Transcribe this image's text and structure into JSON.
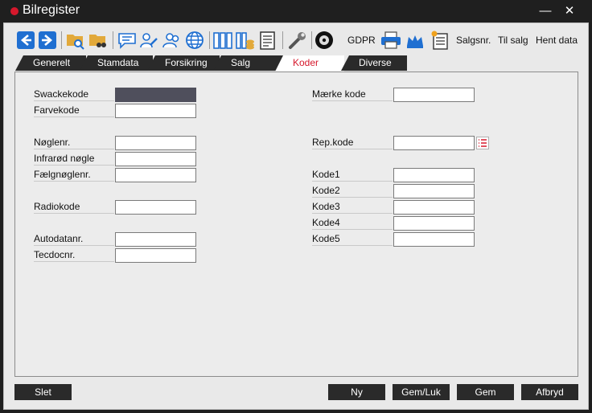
{
  "window": {
    "title": "Bilregister",
    "minimize_glyph": "—",
    "close_glyph": "✕"
  },
  "toolbar": {
    "icons": [
      "back-arrow-icon",
      "forward-arrow-icon",
      "folder-search-icon",
      "folder-binoculars-icon",
      "speech-bubble-icon",
      "user-edit-icon",
      "users-icon",
      "globe-icon",
      "binders-icon",
      "binders-coins-icon",
      "document-list-icon",
      "wrench-icon",
      "tire-icon",
      "printer-icon",
      "crown-icon",
      "new-document-icon"
    ],
    "gdpr": "GDPR",
    "salgsnr": "Salgsnr.",
    "til_salg": "Til salg",
    "hent_data": "Hent data"
  },
  "tabs": [
    {
      "label": "Generelt"
    },
    {
      "label": "Stamdata"
    },
    {
      "label": "Forsikring"
    },
    {
      "label": "Salg"
    },
    {
      "label": "Koder",
      "active": true
    },
    {
      "label": "Diverse"
    }
  ],
  "form": {
    "swackekode": {
      "label": "Swackekode",
      "value": ""
    },
    "farvekode": {
      "label": "Farvekode",
      "value": ""
    },
    "noglenr": {
      "label": "Nøglenr.",
      "value": ""
    },
    "infrarod": {
      "label": "Infrarød nøgle",
      "value": ""
    },
    "faelgnoglenr": {
      "label": "Fælgnøglenr.",
      "value": ""
    },
    "radiokode": {
      "label": "Radiokode",
      "value": ""
    },
    "autodatanr": {
      "label": "Autodatanr.",
      "value": ""
    },
    "tecdocnr": {
      "label": "Tecdocnr.",
      "value": ""
    },
    "maerkekode": {
      "label": "Mærke kode",
      "value": ""
    },
    "repkode": {
      "label": "Rep.kode",
      "value": ""
    },
    "kode1": {
      "label": "Kode1",
      "value": ""
    },
    "kode2": {
      "label": "Kode2",
      "value": ""
    },
    "kode3": {
      "label": "Kode3",
      "value": ""
    },
    "kode4": {
      "label": "Kode4",
      "value": ""
    },
    "kode5": {
      "label": "Kode5",
      "value": ""
    }
  },
  "buttons": {
    "slet": "Slet",
    "ny": "Ny",
    "gem_luk": "Gem/Luk",
    "gem": "Gem",
    "afbryd": "Afbryd"
  },
  "colors": {
    "accent": "#d6182c",
    "tab_dark": "#2a2a2a",
    "toolbar_blue": "#1f6fd1"
  }
}
